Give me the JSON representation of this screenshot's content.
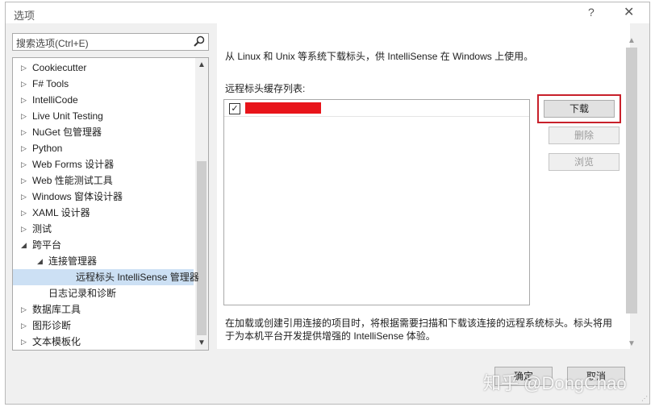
{
  "window": {
    "title": "选项",
    "help": "?",
    "close": "✕"
  },
  "search": {
    "placeholder": "搜索选项(Ctrl+E)"
  },
  "tree": [
    {
      "label": "Cookiecutter",
      "indent": 0,
      "arrow": "▷",
      "selected": false
    },
    {
      "label": "F# Tools",
      "indent": 0,
      "arrow": "▷",
      "selected": false
    },
    {
      "label": "IntelliCode",
      "indent": 0,
      "arrow": "▷",
      "selected": false
    },
    {
      "label": "Live Unit Testing",
      "indent": 0,
      "arrow": "▷",
      "selected": false
    },
    {
      "label": "NuGet 包管理器",
      "indent": 0,
      "arrow": "▷",
      "selected": false
    },
    {
      "label": "Python",
      "indent": 0,
      "arrow": "▷",
      "selected": false
    },
    {
      "label": "Web Forms 设计器",
      "indent": 0,
      "arrow": "▷",
      "selected": false
    },
    {
      "label": "Web 性能测试工具",
      "indent": 0,
      "arrow": "▷",
      "selected": false
    },
    {
      "label": "Windows 窗体设计器",
      "indent": 0,
      "arrow": "▷",
      "selected": false
    },
    {
      "label": "XAML 设计器",
      "indent": 0,
      "arrow": "▷",
      "selected": false
    },
    {
      "label": "测试",
      "indent": 0,
      "arrow": "▷",
      "selected": false
    },
    {
      "label": "跨平台",
      "indent": 0,
      "arrow": "◢",
      "selected": false
    },
    {
      "label": "连接管理器",
      "indent": 1,
      "arrow": "◢",
      "selected": false
    },
    {
      "label": "远程标头 IntelliSense 管理器",
      "indent": 2,
      "arrow": "",
      "selected": true
    },
    {
      "label": "日志记录和诊断",
      "indent": 1,
      "arrow": "",
      "selected": false
    },
    {
      "label": "数据库工具",
      "indent": 0,
      "arrow": "▷",
      "selected": false
    },
    {
      "label": "图形诊断",
      "indent": 0,
      "arrow": "▷",
      "selected": false
    },
    {
      "label": "文本模板化",
      "indent": 0,
      "arrow": "▷",
      "selected": false
    }
  ],
  "content": {
    "description": "从 Linux 和 Unix 等系统下载标头，供 IntelliSense 在 Windows 上使用。",
    "list_label": "远程标头缓存列表:",
    "list_item": {
      "checked": "✓"
    },
    "buttons": {
      "download": "下载",
      "delete": "删除",
      "browse": "浏览"
    },
    "bottom_text": "在加载或创建引用连接的项目时，将根据需要扫描和下载该连接的远程系统标头。标头将用于为本机平台开发提供增强的 IntelliSense 体验。"
  },
  "footer": {
    "ok": "确定",
    "cancel": "取消"
  },
  "watermark": "知乎 @DongChao",
  "colors": {
    "highlight": "#c8202a",
    "redaction": "#e8141a",
    "selection": "#cce0f4"
  }
}
